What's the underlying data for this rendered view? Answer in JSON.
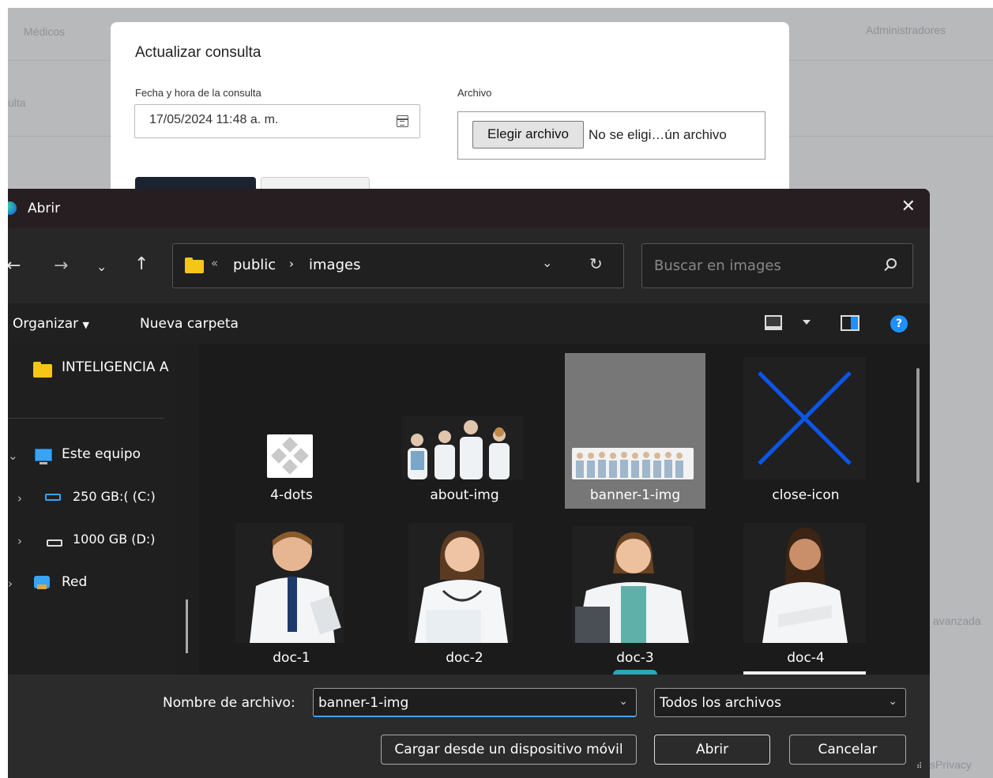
{
  "background": {
    "nav_medicos": "Médicos",
    "nav_admins": "Administradores",
    "left_fragment": "ulta",
    "right_fragment": "avanzada",
    "footer_fragment": "sPrivacy"
  },
  "modal": {
    "title": "Actualizar consulta",
    "date_label": "Fecha y hora de la consulta",
    "date_value": "17/05/2024 11:48 a. m.",
    "file_label": "Archivo",
    "file_button": "Elegir archivo",
    "file_status": "No se eligi…ún archivo"
  },
  "dialog": {
    "title": "Abrir",
    "path": [
      "public",
      "images"
    ],
    "search_placeholder": "Buscar en images",
    "organize": "Organizar",
    "new_folder": "Nueva carpeta",
    "help": "?",
    "tree": [
      {
        "label": "INTELIGENCIA A"
      },
      {
        "label": "Este equipo"
      },
      {
        "label": "250 GB:( (C:)"
      },
      {
        "label": "1000 GB (D:)"
      },
      {
        "label": "Red"
      }
    ],
    "files": [
      {
        "name": "4-dots"
      },
      {
        "name": "about-img"
      },
      {
        "name": "banner-1-img"
      },
      {
        "name": "close-icon"
      },
      {
        "name": "doc-1"
      },
      {
        "name": "doc-2"
      },
      {
        "name": "doc-3"
      },
      {
        "name": "doc-4"
      }
    ],
    "filename_label": "Nombre de archivo:",
    "filename_value": "banner-1-img",
    "filetype_value": "Todos los archivos",
    "btn_mobile": "Cargar desde un dispositivo móvil",
    "btn_open": "Abrir",
    "btn_cancel": "Cancelar",
    "colors": {
      "accent": "#1e90ff",
      "folder": "#f5c518",
      "selected_tile": "#777777"
    }
  }
}
